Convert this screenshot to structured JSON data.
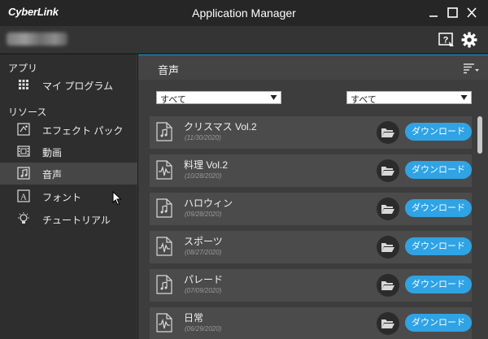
{
  "window": {
    "logo": "CyberLink",
    "title": "Application Manager"
  },
  "sidebar": {
    "sections": [
      {
        "heading": "アプリ",
        "items": [
          {
            "label": "マイ プログラム",
            "icon": "grid-icon",
            "selected": false
          }
        ]
      },
      {
        "heading": "リソース",
        "items": [
          {
            "label": "エフェクト パック",
            "icon": "effect-pack-icon",
            "selected": false
          },
          {
            "label": "動画",
            "icon": "film-icon",
            "selected": false
          },
          {
            "label": "音声",
            "icon": "audio-note-icon",
            "selected": true
          },
          {
            "label": "フォント",
            "icon": "font-icon",
            "selected": false
          },
          {
            "label": "チュートリアル",
            "icon": "lightbulb-icon",
            "selected": false
          }
        ]
      }
    ]
  },
  "main": {
    "title": "音声",
    "filters": [
      {
        "value": "すべて"
      },
      {
        "value": "すべて"
      }
    ],
    "items": [
      {
        "name": "クリスマス Vol.2",
        "date": "(11/30/2020)",
        "icon": "music-note-file-icon",
        "button": "ダウンロード"
      },
      {
        "name": "料理 Vol.2",
        "date": "(10/28/2020)",
        "icon": "waveform-file-icon",
        "button": "ダウンロード"
      },
      {
        "name": "ハロウィン",
        "date": "(09/28/2020)",
        "icon": "music-note-file-icon",
        "button": "ダウンロード"
      },
      {
        "name": "スポーツ",
        "date": "(08/27/2020)",
        "icon": "waveform-file-icon",
        "button": "ダウンロード"
      },
      {
        "name": "パレード",
        "date": "(07/09/2020)",
        "icon": "music-note-file-icon",
        "button": "ダウンロード"
      },
      {
        "name": "日常",
        "date": "(06/29/2020)",
        "icon": "waveform-file-icon",
        "button": "ダウンロード"
      }
    ]
  },
  "colors": {
    "accent": "#2fa3e4",
    "titlebar": "#262626",
    "sidebar": "#2e2e2e",
    "content": "#3d3d3d",
    "row": "#4b4b4b"
  }
}
